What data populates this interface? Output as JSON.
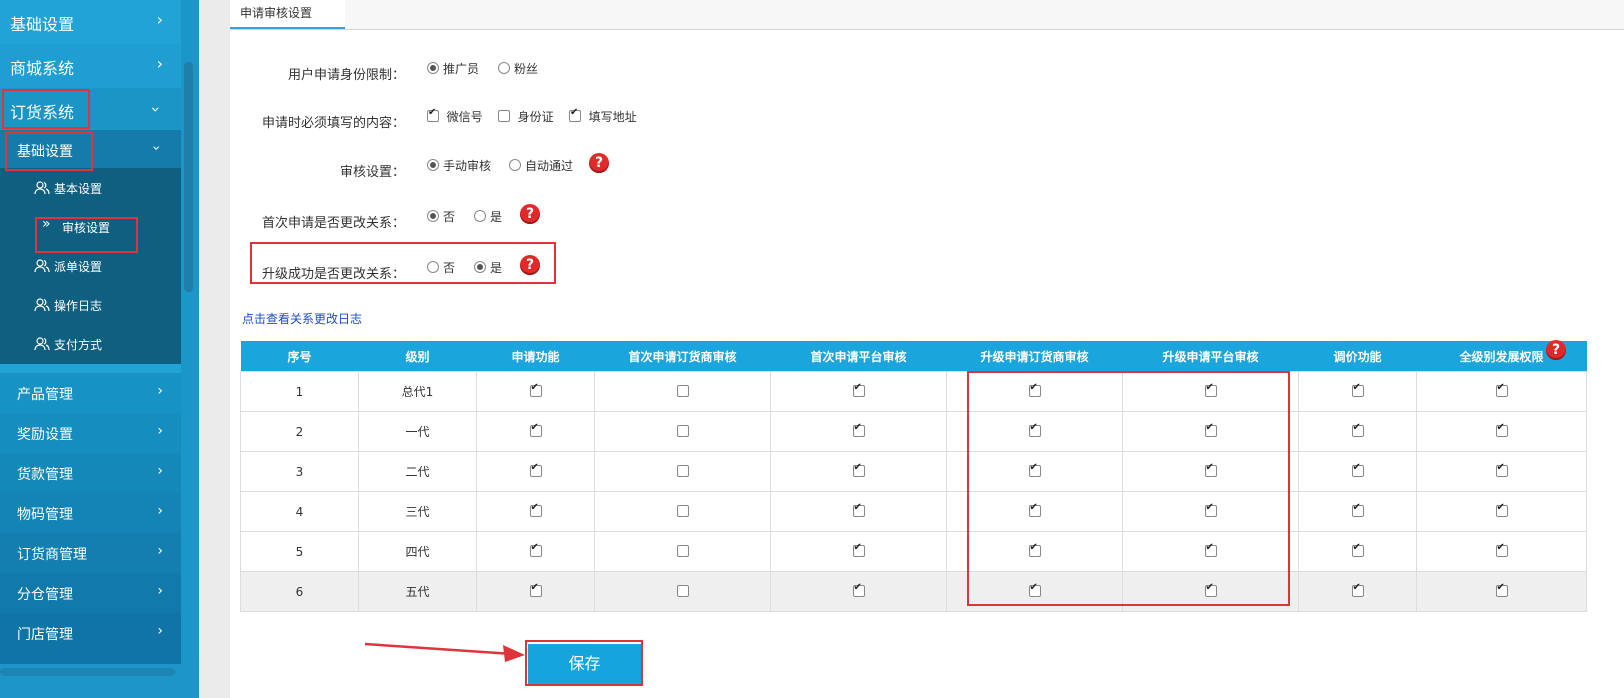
{
  "sidebar": {
    "items": [
      {
        "label": "基础设置"
      },
      {
        "label": "商城系统"
      },
      {
        "label": "订货系统"
      }
    ],
    "sub_open": {
      "label": "基础设置"
    },
    "leaves": [
      {
        "label": "基本设置"
      },
      {
        "label": "审核设置"
      },
      {
        "label": "派单设置"
      },
      {
        "label": "操作日志"
      },
      {
        "label": "支付方式"
      }
    ],
    "sub_items": [
      {
        "label": "产品管理"
      },
      {
        "label": "奖励设置"
      },
      {
        "label": "货款管理"
      },
      {
        "label": "物码管理"
      },
      {
        "label": "订货商管理"
      },
      {
        "label": "分仓管理"
      },
      {
        "label": "门店管理"
      }
    ]
  },
  "tab": {
    "label": "申请审核设置"
  },
  "form": {
    "identity": {
      "label": "用户申请身份限制：",
      "options": [
        "推广员",
        "粉丝"
      ],
      "selected": "推广员"
    },
    "required": {
      "label": "申请时必须填写的内容：",
      "options": [
        "微信号",
        "身份证",
        "填写地址"
      ],
      "checked": [
        "微信号",
        "填写地址"
      ]
    },
    "audit": {
      "label": "审核设置：",
      "options": [
        "手动审核",
        "自动通过"
      ],
      "selected": "手动审核"
    },
    "first_change": {
      "label": "首次申请是否更改关系：",
      "options": [
        "否",
        "是"
      ],
      "selected": "否"
    },
    "upgrade_change": {
      "label": "升级成功是否更改关系：",
      "options": [
        "否",
        "是"
      ],
      "selected": "是"
    }
  },
  "help_glyph": "?",
  "log_link": "点击查看关系更改日志",
  "table": {
    "headers": [
      "序号",
      "级别",
      "申请功能",
      "首次申请订货商审核",
      "首次申请平台审核",
      "升级申请订货商审核",
      "升级申请平台审核",
      "调价功能",
      "全级别发展权限"
    ],
    "rows": [
      {
        "no": "1",
        "level": "总代1",
        "checks": [
          true,
          false,
          true,
          true,
          true,
          true,
          true
        ]
      },
      {
        "no": "2",
        "level": "一代",
        "checks": [
          true,
          false,
          true,
          true,
          true,
          true,
          true
        ]
      },
      {
        "no": "3",
        "level": "二代",
        "checks": [
          true,
          false,
          true,
          true,
          true,
          true,
          true
        ]
      },
      {
        "no": "4",
        "level": "三代",
        "checks": [
          true,
          false,
          true,
          true,
          true,
          true,
          true
        ]
      },
      {
        "no": "5",
        "level": "四代",
        "checks": [
          true,
          false,
          true,
          true,
          true,
          true,
          true
        ]
      },
      {
        "no": "6",
        "level": "五代",
        "checks": [
          true,
          false,
          true,
          true,
          true,
          true,
          true
        ]
      }
    ]
  },
  "save_label": "保存",
  "colors": {
    "accent": "#1aa5dc",
    "sidebar": "#21a3d6",
    "leaf_bg": "#0f5f81",
    "highlight": "#e0343c",
    "help": "#e02a2a"
  }
}
